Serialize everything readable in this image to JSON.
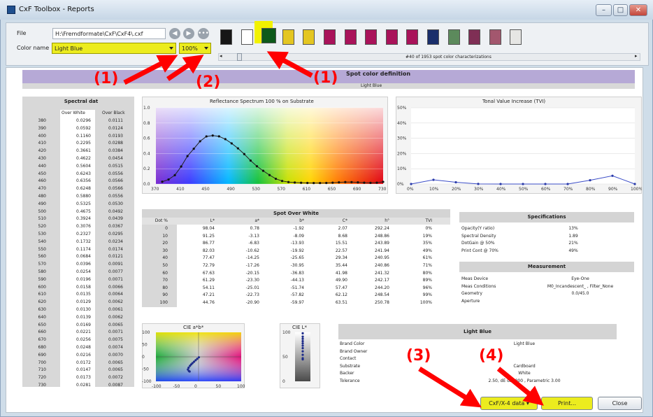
{
  "window": {
    "title": "CxF Toolbox - Reports",
    "controls": [
      "–",
      "□",
      "✕"
    ]
  },
  "file": {
    "label": "File",
    "path": "H:\\Fremdformate\\CxF\\CxF4\\.cxf"
  },
  "colorname": {
    "label": "Color name",
    "value": "Light Blue"
  },
  "zoom": {
    "value": "100%"
  },
  "nav_icons": [
    "arrow-left-icon",
    "arrow-right-icon",
    "more-icon"
  ],
  "swatches": [
    "#161616",
    "#ffffff",
    "#0e5a1a",
    "#e4c621",
    "#e4c621",
    "#a9135a",
    "#a9135a",
    "#a9135a",
    "#a9135a",
    "#a9135a",
    "#1a2f6b",
    "#5c8a5c",
    "#7f2f55",
    "#a3576e",
    "#e6e6e4"
  ],
  "status": "#40 of 1953 spot color characterizations",
  "header": {
    "title": "Spot color definition",
    "subtitle": "Light Blue"
  },
  "spectral": {
    "title": "Spectral dat",
    "col1": "Over White",
    "col2": "Over Black",
    "nm": [
      "380",
      "390",
      "400",
      "410",
      "420",
      "430",
      "440",
      "450",
      "460",
      "470",
      "480",
      "490",
      "500",
      "510",
      "520",
      "530",
      "540",
      "550",
      "560",
      "570",
      "580",
      "590",
      "600",
      "610",
      "620",
      "630",
      "640",
      "650",
      "660",
      "670",
      "680",
      "690",
      "700",
      "710",
      "720",
      "730"
    ],
    "white": [
      "0.0296",
      "0.0592",
      "0.1160",
      "0.2295",
      "0.3661",
      "0.4622",
      "0.5604",
      "0.6243",
      "0.6356",
      "0.6248",
      "0.5880",
      "0.5325",
      "0.4675",
      "0.3924",
      "0.3076",
      "0.2327",
      "0.1732",
      "0.1174",
      "0.0684",
      "0.0396",
      "0.0254",
      "0.0196",
      "0.0158",
      "0.0135",
      "0.0129",
      "0.0130",
      "0.0139",
      "0.0169",
      "0.0221",
      "0.0256",
      "0.0248",
      "0.0216",
      "0.0172",
      "0.0147",
      "0.0173",
      "0.0281"
    ],
    "black": [
      "0.0111",
      "0.0124",
      "0.0193",
      "0.0288",
      "0.0384",
      "0.0454",
      "0.0515",
      "0.0556",
      "0.0566",
      "0.0566",
      "0.0556",
      "0.0530",
      "0.0492",
      "0.0439",
      "0.0367",
      "0.0295",
      "0.0234",
      "0.0174",
      "0.0121",
      "0.0091",
      "0.0077",
      "0.0071",
      "0.0066",
      "0.0064",
      "0.0062",
      "0.0061",
      "0.0062",
      "0.0065",
      "0.0071",
      "0.0075",
      "0.0074",
      "0.0070",
      "0.0065",
      "0.0065",
      "0.0072",
      "0.0087"
    ]
  },
  "refl_chart": {
    "title": "Reflectance Spectrum 100 % on Substrate",
    "yticks": [
      "1.0",
      "0.8",
      "0.6",
      "0.4",
      "0.2",
      "0.0"
    ],
    "xticks": [
      "370",
      "410",
      "450",
      "490",
      "530",
      "570",
      "610",
      "650",
      "690",
      "730"
    ]
  },
  "tvi_chart": {
    "title": "Tonal Value Increase (TVI)",
    "yticks": [
      "50%",
      "40%",
      "30%",
      "20%",
      "10%",
      "0%"
    ],
    "xticks": [
      "0%",
      "10%",
      "20%",
      "30%",
      "40%",
      "50%",
      "60%",
      "70%",
      "80%",
      "90%",
      "100%"
    ]
  },
  "sow": {
    "title": "Spot Over White",
    "headers": [
      "Dot %",
      "L*",
      "a*",
      "b*",
      "C*",
      "h°",
      "TVI"
    ],
    "rows": [
      [
        "0",
        "98.04",
        "0.78",
        "-1.92",
        "2.07",
        "292.24",
        "0%"
      ],
      [
        "10",
        "91.25",
        "-3.13",
        "-8.09",
        "8.68",
        "248.86",
        "19%"
      ],
      [
        "20",
        "86.77",
        "-6.83",
        "-13.93",
        "15.51",
        "243.89",
        "35%"
      ],
      [
        "30",
        "82.03",
        "-10.62",
        "-19.92",
        "22.57",
        "241.94",
        "49%"
      ],
      [
        "40",
        "77.47",
        "-14.25",
        "-25.65",
        "29.34",
        "240.95",
        "61%"
      ],
      [
        "50",
        "72.79",
        "-17.26",
        "-30.95",
        "35.44",
        "240.86",
        "71%"
      ],
      [
        "60",
        "67.63",
        "-20.15",
        "-36.83",
        "41.98",
        "241.32",
        "80%"
      ],
      [
        "70",
        "61.29",
        "-23.30",
        "-44.13",
        "49.90",
        "242.17",
        "89%"
      ],
      [
        "80",
        "54.11",
        "-25.01",
        "-51.74",
        "57.47",
        "244.20",
        "96%"
      ],
      [
        "90",
        "47.21",
        "-22.73",
        "-57.82",
        "62.12",
        "248.54",
        "99%"
      ],
      [
        "100",
        "44.76",
        "-20.90",
        "-59.97",
        "63.51",
        "250.78",
        "100%"
      ]
    ]
  },
  "specifications": {
    "title": "Specifications",
    "rows": [
      [
        "Opacity(Y ratio)",
        "13%"
      ],
      [
        "Spectral Density",
        "1.89"
      ],
      [
        "DotGain @ 50%",
        "21%"
      ],
      [
        "Print Cont @ 70%",
        "49%"
      ]
    ]
  },
  "measurement": {
    "title": "Measurement",
    "rows": [
      [
        "Meas Device",
        "Eye-One"
      ],
      [
        "Meas Conditions",
        "M0_Incandescent_ , Filter_None"
      ],
      [
        "Geometry",
        "0.0/45.0"
      ],
      [
        "Aperture",
        ""
      ]
    ]
  },
  "cie_ab": {
    "title": "CIE a*b*",
    "yticks": [
      "100",
      "50",
      "0",
      "-50",
      "-100"
    ],
    "xticks": [
      "-100",
      "-50",
      "0",
      "50",
      "100"
    ]
  },
  "cie_l": {
    "title": "CIE L*",
    "yticks": [
      "100",
      "50",
      "0"
    ]
  },
  "info": {
    "title": "Light Blue",
    "rows": [
      [
        "Brand Color",
        "Light Blue"
      ],
      [
        "Brand Owner",
        ""
      ],
      [
        "Contact",
        ""
      ],
      [
        "Substrate",
        "Cardboard"
      ],
      [
        "Backer",
        "White"
      ],
      [
        "Tolerance",
        "2.50, dE dE2000 , Parametric 3.00"
      ]
    ]
  },
  "buttons": {
    "export": "CxF/X-4 data",
    "print": "Print...",
    "close": "Close"
  },
  "annotations": [
    "(1)",
    "(2)",
    "(1)",
    "(3)",
    "(4)"
  ]
}
